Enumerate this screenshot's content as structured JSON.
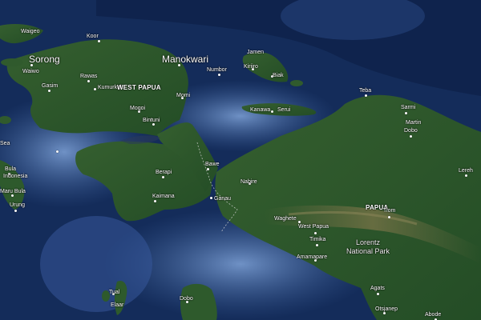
{
  "map": {
    "view": "satellite",
    "colors": {
      "deep_water": "#112a57",
      "shallow_water": "#5d83bd",
      "land": "#2e5a2c",
      "highland": "#5f6a3c",
      "label": "#ffffff"
    },
    "place_labels": {
      "waigeo": "Waigeo",
      "koor": "Koor",
      "sorong": "Sorong",
      "waiwo": "Waiwo",
      "rawas": "Rawas",
      "kumurkek": "Kumurkek",
      "west_papua": "WEST PAPUA",
      "manokwari": "Manokwari",
      "jamen": "Jamen",
      "kiriiro": "Kiriiro",
      "numbor": "Numbor",
      "biak": "Biak",
      "gasim": "Gasim",
      "momi": "Momi",
      "mogoi": "Mogoi",
      "bintuni": "Bintuni",
      "kanawa": "Kanawa",
      "serui": "Serui",
      "teba": "Teba",
      "sarmi": "Sarmi",
      "martin": "Martin",
      "dobo_north": "Dobo",
      "sea": "Sea",
      "bula": "Bula",
      "indonesia": "Indonesia",
      "maru_bula": "Maru Bula",
      "urung": "Urung",
      "berapi": "Berapi",
      "bawe": "Bawe",
      "kaimana": "Kaimana",
      "ganau": "Ganau",
      "nabire": "Nabire",
      "lereh": "Lereh",
      "waghete": "Waghete",
      "papua": "PAPUA",
      "tiom": "Tiom",
      "west_papua_town": "West Papua",
      "timika": "Timika",
      "lorentz_national_park": "Lorentz\nNational Park",
      "amamapare": "Amamapare",
      "agats": "Agats",
      "otsjanep": "Otsjanep",
      "abode": "Abode",
      "tual": "Tual",
      "elaar": "Elaar",
      "dobo_south": "Dobo"
    }
  }
}
